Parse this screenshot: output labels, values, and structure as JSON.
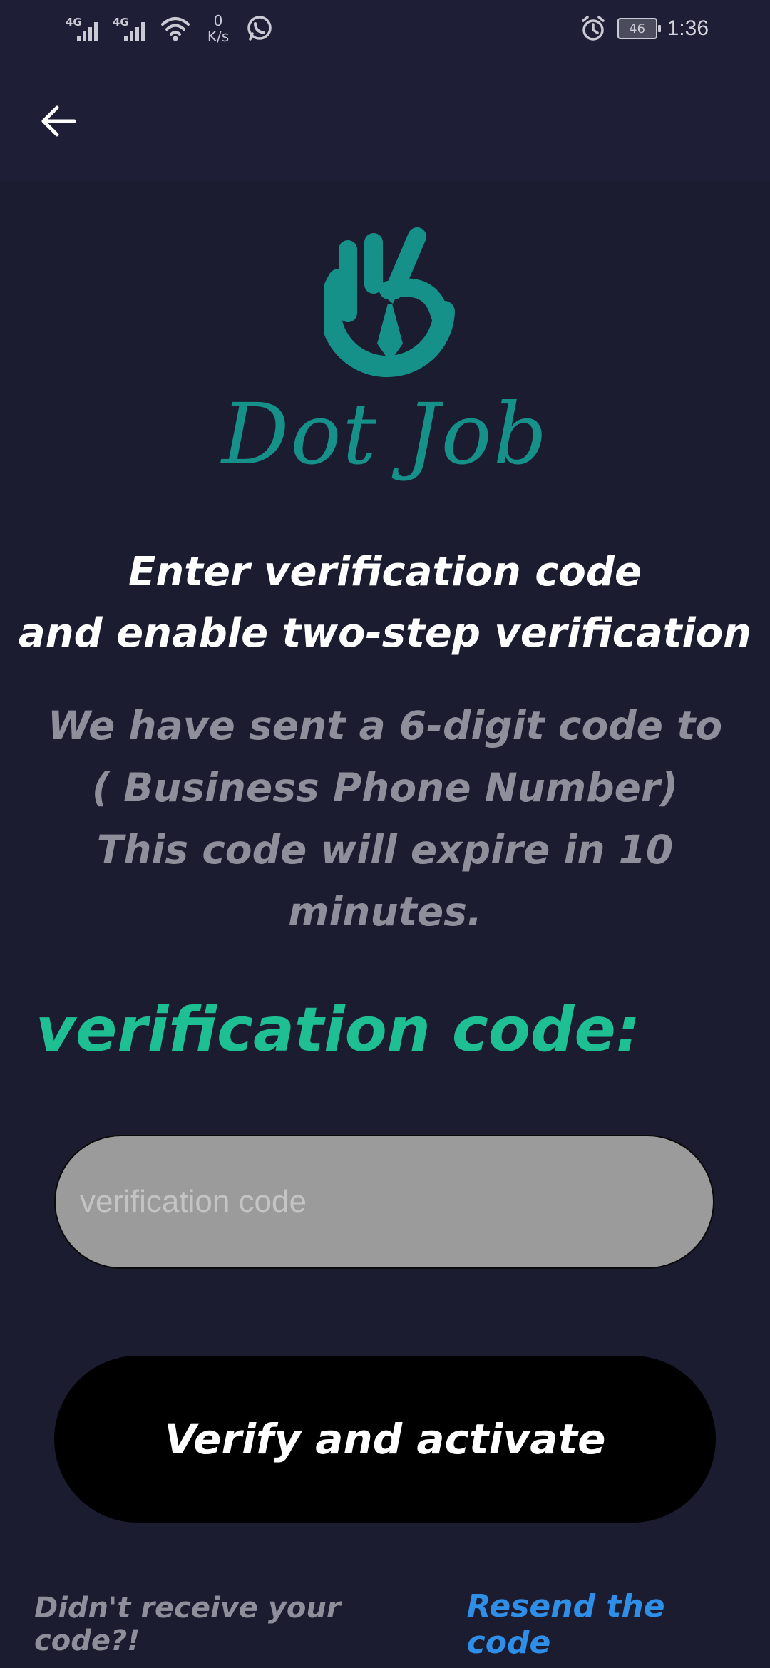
{
  "status_bar": {
    "signal1_label": "4G",
    "signal2_label": "4G",
    "net_speed_value": "0",
    "net_speed_unit": "K/s",
    "battery_level": "46",
    "time": "1:36",
    "icons": [
      "signal-icon",
      "wifi-icon",
      "whatsapp-icon",
      "alarm-icon",
      "battery-icon"
    ]
  },
  "app_bar": {
    "back_icon": "back-arrow-icon"
  },
  "logo": {
    "brand_name": "Dot Job",
    "mark_icon": "hand-tie-logo-icon",
    "color": "#16918a"
  },
  "heading": {
    "line1": "Enter verification code",
    "line2": "and enable two-step verification"
  },
  "info": {
    "line1": "We have sent a 6-digit code to",
    "line2": "( Business Phone Number)",
    "line3": "This code will expire in 10 minutes."
  },
  "form": {
    "label": "verification code:",
    "input_placeholder": "verification code",
    "input_value": "",
    "submit_label": "Verify and activate"
  },
  "footer": {
    "prompt": "Didn't receive your code?!",
    "resend_label": "Resend the code"
  },
  "colors": {
    "background": "#1b1c30",
    "accent": "#1fbf94",
    "link": "#2f8fe8",
    "muted_text": "#8e8f9a"
  }
}
